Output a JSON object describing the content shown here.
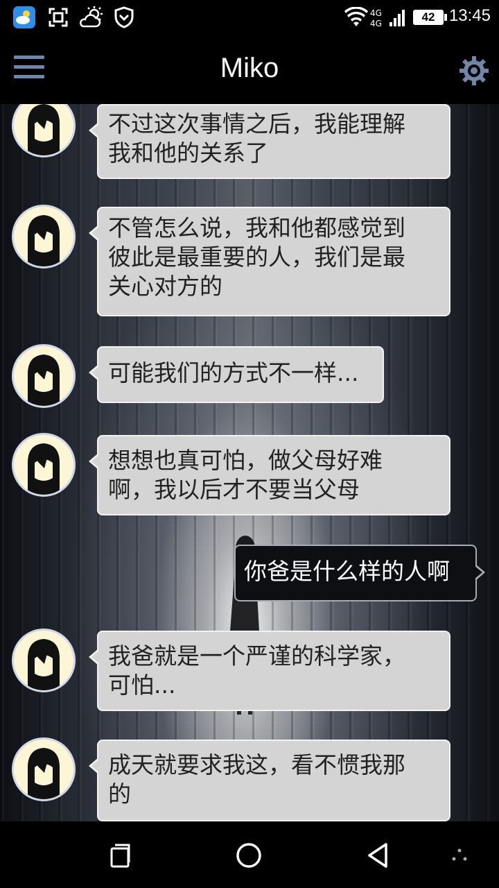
{
  "status_bar": {
    "time": "13:45",
    "battery": "42",
    "icons": [
      "weather-app-icon",
      "scan-icon",
      "weather-sun-cloud-icon",
      "shield-icon",
      "wifi-icon",
      "signal-icon"
    ]
  },
  "header": {
    "title": "Miko",
    "menu_icon": "hamburger-menu-icon",
    "settings_icon": "gear-icon"
  },
  "messages": [
    {
      "side": "left",
      "text": "不过这次事情之后，我能理解我和他的关系了",
      "lines": [
        "不过这次事情之后，我能理解",
        "我和他的关系了"
      ]
    },
    {
      "side": "left",
      "text": "不管怎么说，我和他都感觉到彼此是最重要的人，我们是最关心对方的",
      "lines": [
        "不管怎么说，我和他都感觉到",
        "彼此是最重要的人，我们是最",
        "关心对方的"
      ]
    },
    {
      "side": "left",
      "text": "可能我们的方式不一样...",
      "lines": [
        "可能我们的方式不一样..."
      ]
    },
    {
      "side": "left",
      "text": "想想也真可怕，做父母好难啊，我以后才不要当父母",
      "lines": [
        "想想也真可怕，做父母好难",
        "啊，我以后才不要当父母"
      ]
    },
    {
      "side": "right",
      "text": "你爸是什么样的人啊",
      "lines": [
        "你爸是什么样的人啊"
      ]
    },
    {
      "side": "left",
      "text": "我爸就是一个严谨的科学家，可怕...",
      "lines": [
        "我爸就是一个严谨的科学家，",
        "可怕..."
      ]
    },
    {
      "side": "left",
      "text": "成天就要求我这，看不惯我那的",
      "lines": [
        "成天就要求我这，看不惯我那",
        "的"
      ]
    }
  ],
  "nav": {
    "recents_icon": "recents-icon",
    "home_icon": "home-icon",
    "back_icon": "back-icon",
    "more_icon": "more-dots-icon"
  }
}
